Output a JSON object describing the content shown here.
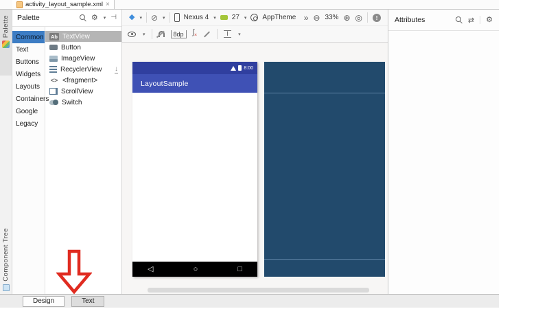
{
  "editor_tab": {
    "title": "activity_layout_sample.xml"
  },
  "left_strip": {
    "top_label": "Palette",
    "bottom_label": "Component Tree"
  },
  "palette": {
    "title": "Palette",
    "categories": [
      "Common",
      "Text",
      "Buttons",
      "Widgets",
      "Layouts",
      "Containers",
      "Google",
      "Legacy"
    ],
    "selected_category": "Common",
    "components": [
      {
        "badge": "Ab",
        "label": "TextView"
      },
      {
        "label": "Button"
      },
      {
        "label": "ImageView"
      },
      {
        "label": "RecyclerView"
      },
      {
        "badge": "<>",
        "label": "<fragment>"
      },
      {
        "label": "ScrollView"
      },
      {
        "label": "Switch"
      }
    ],
    "selected_component": "TextView"
  },
  "toolbar": {
    "device": "Nexus 4",
    "api_level": "27",
    "theme": "AppTheme",
    "zoom": "33%",
    "default_margin": "8dp"
  },
  "preview": {
    "app_title": "LayoutSample",
    "status_time": "8:00",
    "colors": {
      "status_bar": "#303F9F",
      "app_bar": "#3F51B5",
      "blueprint": "#224A6C"
    }
  },
  "attributes": {
    "title": "Attributes"
  },
  "bottom_tabs": {
    "design": "Design",
    "text": "Text"
  },
  "icons": {
    "close": "×",
    "dropdown": "▾",
    "layers": "◆",
    "orientation": "⊘",
    "overflow": "»",
    "zoom_out": "⊖",
    "zoom_in": "⊕",
    "zoom_fit": "◎",
    "warning_mark": "!",
    "gear": "⚙",
    "hide_panel": "⊣",
    "swap": "⇄",
    "download": "↓",
    "fx": "ʃ",
    "fx_x": "×",
    "pack": "I",
    "nav_back": "◁",
    "nav_home": "○",
    "nav_recents": "□"
  }
}
